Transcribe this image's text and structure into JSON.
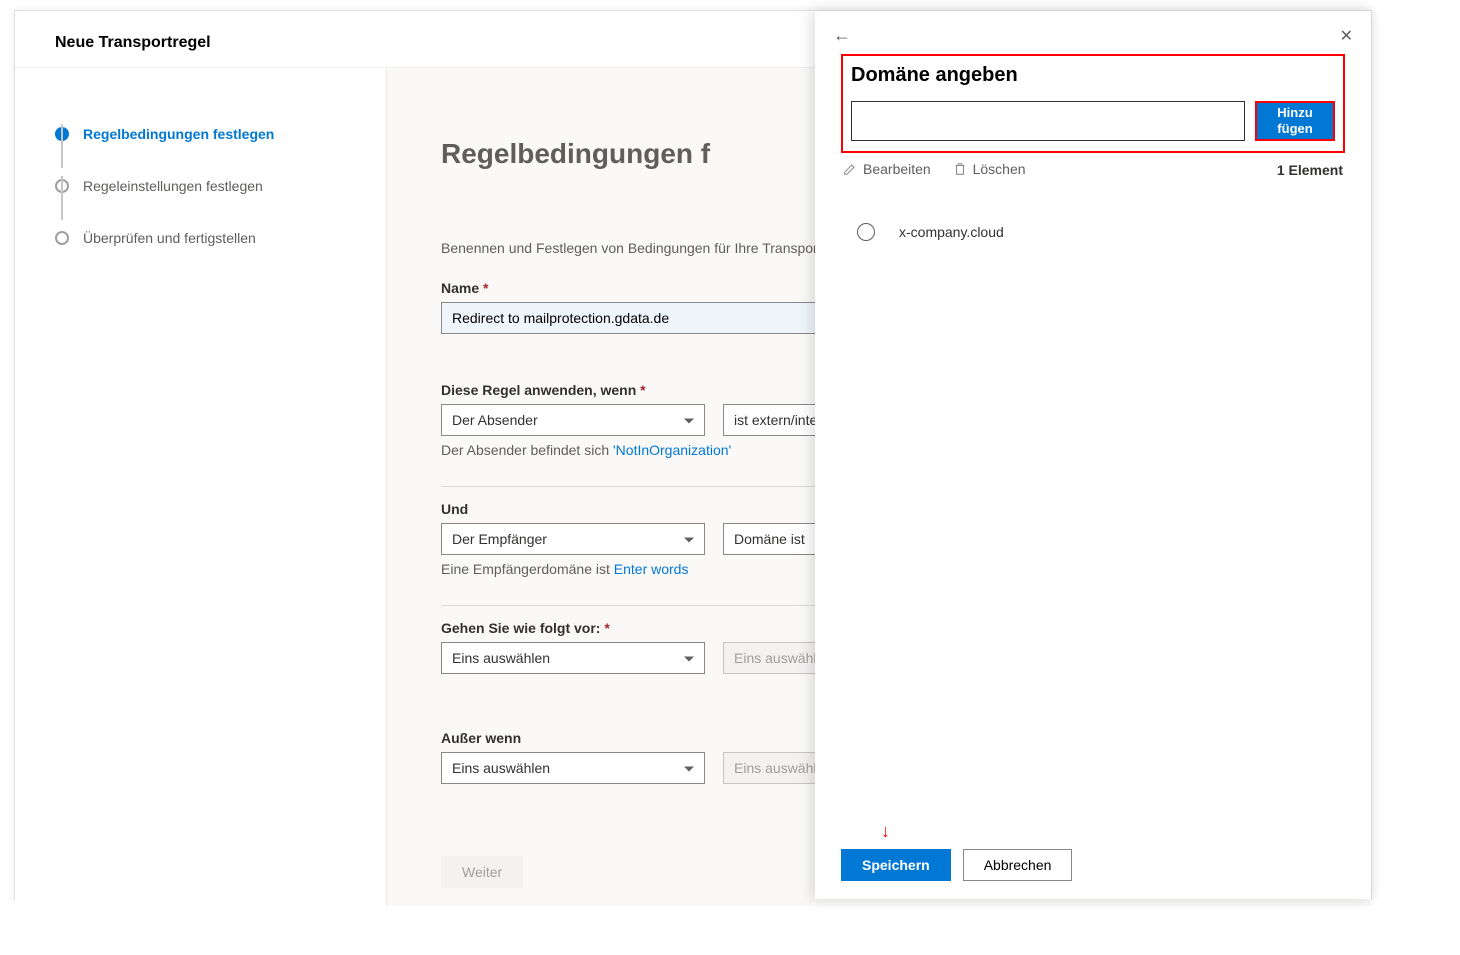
{
  "header": {
    "title": "Neue Transportregel"
  },
  "steps": [
    {
      "label": "Regelbedingungen festlegen",
      "active": true
    },
    {
      "label": "Regeleinstellungen festlegen",
      "active": false
    },
    {
      "label": "Überprüfen und fertigstellen",
      "active": false
    }
  ],
  "main": {
    "heading": "Regelbedingungen f",
    "description": "Benennen und Festlegen von Bedingungen für Ihre Transportreg",
    "name_label": "Name",
    "name_value": "Redirect to mailprotection.gdata.de",
    "apply_label": "Diese Regel anwenden, wenn",
    "apply_select1": "Der Absender",
    "apply_select2": "ist extern/inte",
    "apply_hint_prefix": "Der Absender befindet sich ",
    "apply_hint_link": "'NotInOrganization'",
    "and_label": "Und",
    "and_select1": "Der Empfänger",
    "and_select2": "Domäne ist",
    "and_hint_prefix": "Eine Empfängerdomäne ist ",
    "and_hint_link": "Enter words",
    "do_label": "Gehen Sie wie folgt vor:",
    "do_select1": "Eins auswählen",
    "do_select2": "Eins auswähle",
    "except_label": "Außer wenn",
    "except_select1": "Eins auswählen",
    "except_select2": "Eins auswähle",
    "next_label": "Weiter"
  },
  "flyout": {
    "title": "Domäne angeben",
    "add_button": "Hinzu\nfügen",
    "edit_label": "Bearbeiten",
    "delete_label": "Löschen",
    "count_label": "1 Element",
    "domains": [
      {
        "name": "x-company.cloud"
      }
    ],
    "save_label": "Speichern",
    "cancel_label": "Abbrechen"
  }
}
